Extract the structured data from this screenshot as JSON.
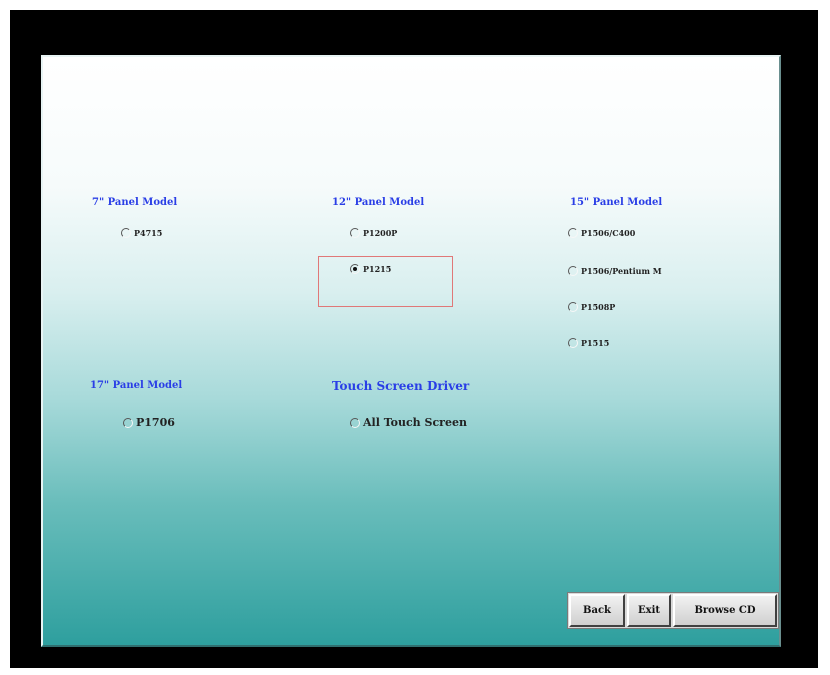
{
  "groups": {
    "panel7": {
      "title": "7\" Panel Model",
      "options": [
        "P4715"
      ]
    },
    "panel12": {
      "title": "12\" Panel Model",
      "options": [
        "P1200P",
        "P1215"
      ],
      "selected": "P1215"
    },
    "panel15": {
      "title": "15\" Panel Model",
      "options": [
        "P1506/C400",
        "P1506/Pentium M",
        "P1508P",
        "P1515"
      ]
    },
    "panel17": {
      "title": "17\" Panel Model",
      "options": [
        "P1706"
      ]
    },
    "touch": {
      "title": "Touch Screen Driver",
      "options": [
        "All Touch Screen"
      ]
    }
  },
  "buttons": {
    "back": "Back",
    "exit": "Exit",
    "browse": "Browse CD"
  },
  "colors": {
    "title_blue": "#2a3ee6",
    "highlight_red": "#e07878",
    "teal_bottom": "#2e9f9e"
  }
}
